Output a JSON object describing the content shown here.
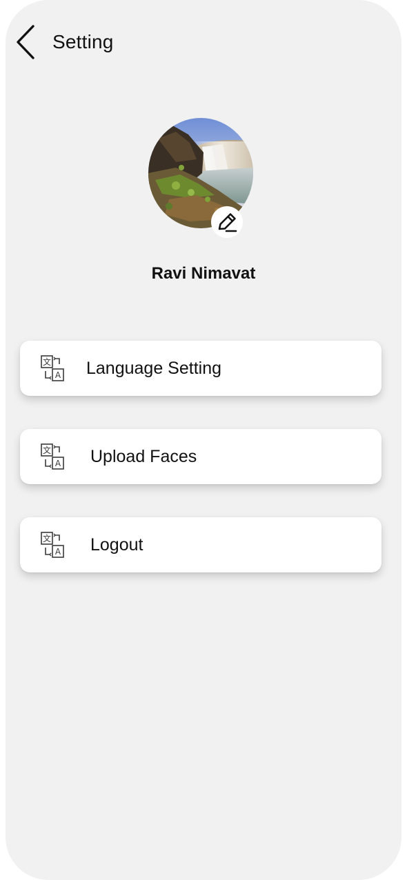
{
  "header": {
    "title": "Setting",
    "back_icon": "chevron-left-icon"
  },
  "profile": {
    "name": "Ravi Nimavat",
    "avatar_subject": "waterfall landscape photo",
    "edit_icon": "pencil-icon"
  },
  "menu": {
    "items": [
      {
        "label": "Language Setting",
        "icon": "translate-icon"
      },
      {
        "label": "Upload Faces",
        "icon": "translate-icon"
      },
      {
        "label": "Logout",
        "icon": "translate-icon"
      }
    ]
  },
  "colors": {
    "background": "#f1f1f1",
    "card": "#ffffff",
    "text": "#111111"
  }
}
